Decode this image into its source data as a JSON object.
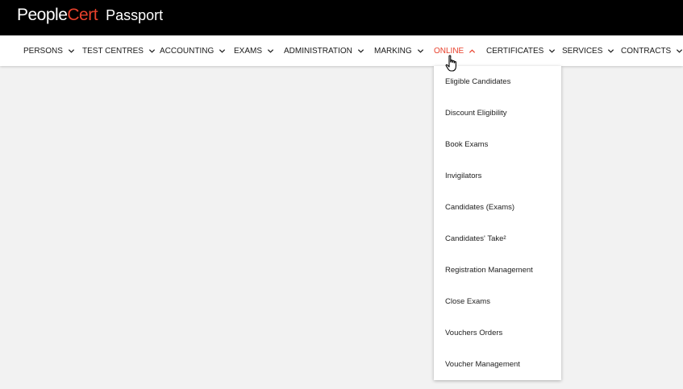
{
  "header": {
    "logo_people": "People",
    "logo_cert": "Cert",
    "app_name": "Passport",
    "brand_color": "#e8412c"
  },
  "nav": {
    "items": [
      {
        "label": "PERSONS",
        "chevron": "chevron-down-icon"
      },
      {
        "label": "TEST CENTRES",
        "chevron": "chevron-down-icon"
      },
      {
        "label": "ACCOUNTING",
        "chevron": "chevron-down-icon"
      },
      {
        "label": "EXAMS",
        "chevron": "chevron-down-icon"
      },
      {
        "label": "ADMINISTRATION",
        "chevron": "chevron-down-icon"
      },
      {
        "label": "MARKING",
        "chevron": "chevron-down-icon"
      },
      {
        "label": "ONLINE",
        "chevron": "chevron-up-icon",
        "active": true
      },
      {
        "label": "CERTIFICATES",
        "chevron": "chevron-down-icon"
      },
      {
        "label": "SERVICES",
        "chevron": "chevron-down-icon"
      },
      {
        "label": "CONTRACTS",
        "chevron": "chevron-down-icon"
      }
    ]
  },
  "online_menu": {
    "items": [
      "Eligible Candidates",
      "Discount Eligibility",
      "Book Exams",
      "Invigilators",
      "Candidates (Exams)",
      "Candidates' Take²",
      "Registration Management",
      "Close Exams",
      "Vouchers Orders",
      "Voucher Management"
    ]
  }
}
